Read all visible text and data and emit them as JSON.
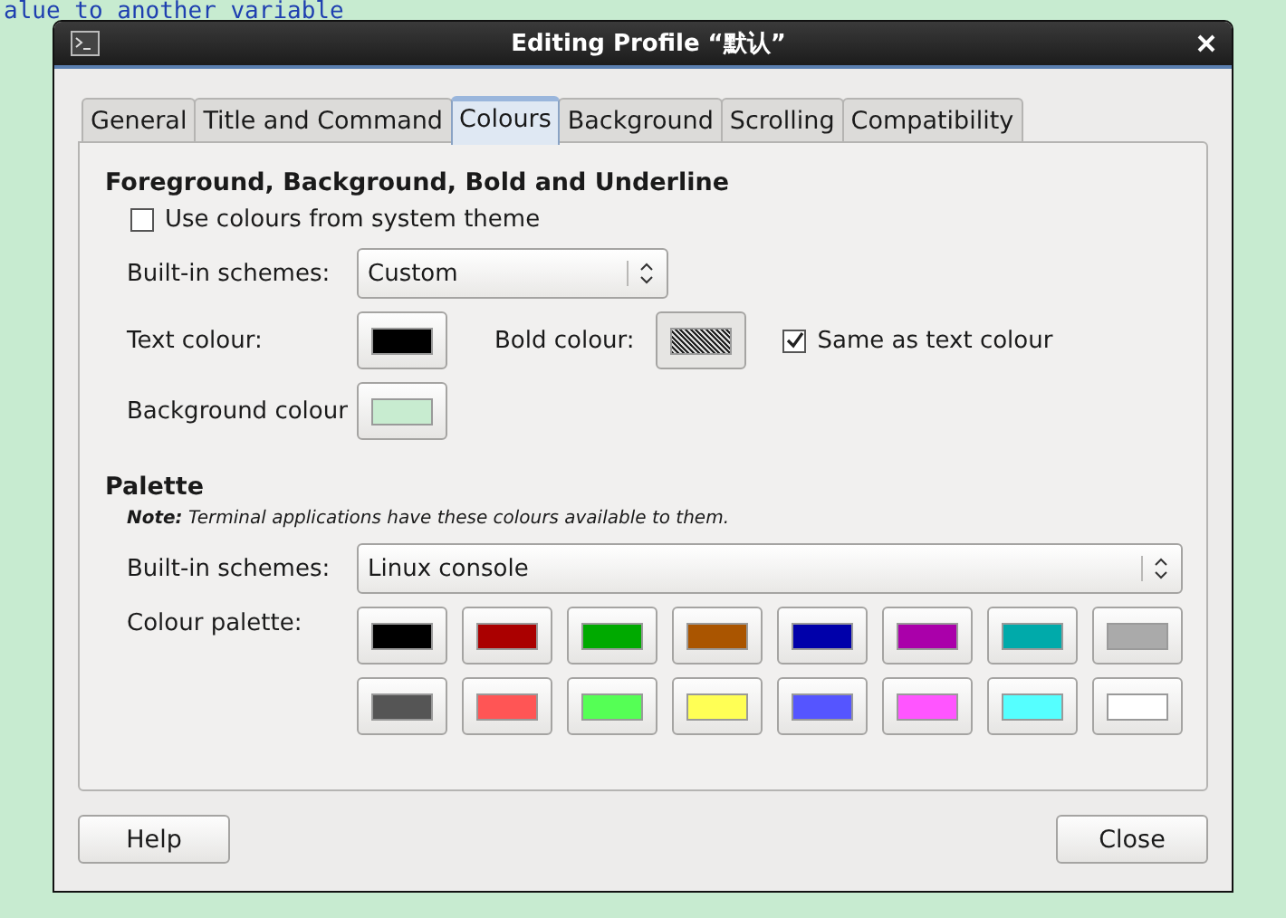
{
  "background_text": "alue to another variable",
  "window": {
    "title": "Editing Profile “默认”"
  },
  "tabs": [
    {
      "label": "General",
      "selected": false
    },
    {
      "label": "Title and Command",
      "selected": false
    },
    {
      "label": "Colours",
      "selected": true
    },
    {
      "label": "Background",
      "selected": false
    },
    {
      "label": "Scrolling",
      "selected": false
    },
    {
      "label": "Compatibility",
      "selected": false
    }
  ],
  "foreground_section": {
    "heading": "Foreground, Background, Bold and Underline",
    "use_system_colours": {
      "label": "Use colours from system theme",
      "checked": false
    },
    "builtin_schemes": {
      "label": "Built-in schemes:",
      "value": "Custom"
    },
    "text_colour": {
      "label": "Text colour:",
      "color": "#000000"
    },
    "bold_colour": {
      "label": "Bold colour:",
      "disabled": true
    },
    "same_as_text": {
      "label": "Same as text colour",
      "checked": true
    },
    "background_colour": {
      "label": "Background colour",
      "color": "#c8ecd0"
    }
  },
  "palette_section": {
    "heading": "Palette",
    "note": "**Note:** Terminal applications have these colours available to them.",
    "builtin_schemes": {
      "label": "Built-in schemes:",
      "value": "Linux console"
    },
    "palette_label": "Colour palette:",
    "colours": [
      {
        "color": "#000000"
      },
      {
        "color": "#aa0000"
      },
      {
        "color": "#00aa00"
      },
      {
        "color": "#aa5500"
      },
      {
        "color": "#0000aa"
      },
      {
        "color": "#aa00aa"
      },
      {
        "color": "#00aaaa"
      },
      {
        "color": "#aaaaaa"
      },
      {
        "color": "#555555"
      },
      {
        "color": "#ff5555"
      },
      {
        "color": "#55ff55"
      },
      {
        "color": "#ffff55"
      },
      {
        "color": "#5555ff"
      },
      {
        "color": "#ff55ff"
      },
      {
        "color": "#55ffff"
      },
      {
        "color": "#ffffff"
      }
    ]
  },
  "buttons": {
    "help": "Help",
    "close": "Close"
  }
}
